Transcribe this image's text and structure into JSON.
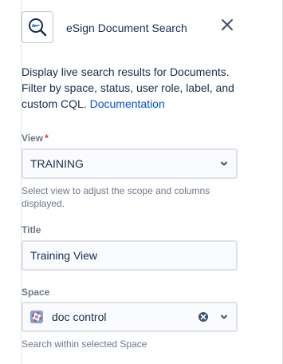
{
  "header": {
    "title": "eSign Document Search",
    "app_icon": "magnifier-signature-icon",
    "close_icon": "close-icon"
  },
  "description": {
    "text": "Display live search results for Documents. Filter by space, status, user role, label, and custom CQL.",
    "link_label": "Documentation"
  },
  "view_field": {
    "label": "View",
    "required_mark": "*",
    "value": "TRAINING",
    "helper": "Select view to adjust the scope and columns displayed."
  },
  "title_field": {
    "label": "Title",
    "value": "Training View"
  },
  "space_field": {
    "label": "Space",
    "value": "doc control",
    "helper": "Search within selected Space"
  },
  "colors": {
    "link": "#0052cc",
    "text": "#172b4d",
    "label": "#6b778c",
    "required": "#de350b",
    "border": "#dfe1e6",
    "input_bg": "#fafbfc"
  }
}
